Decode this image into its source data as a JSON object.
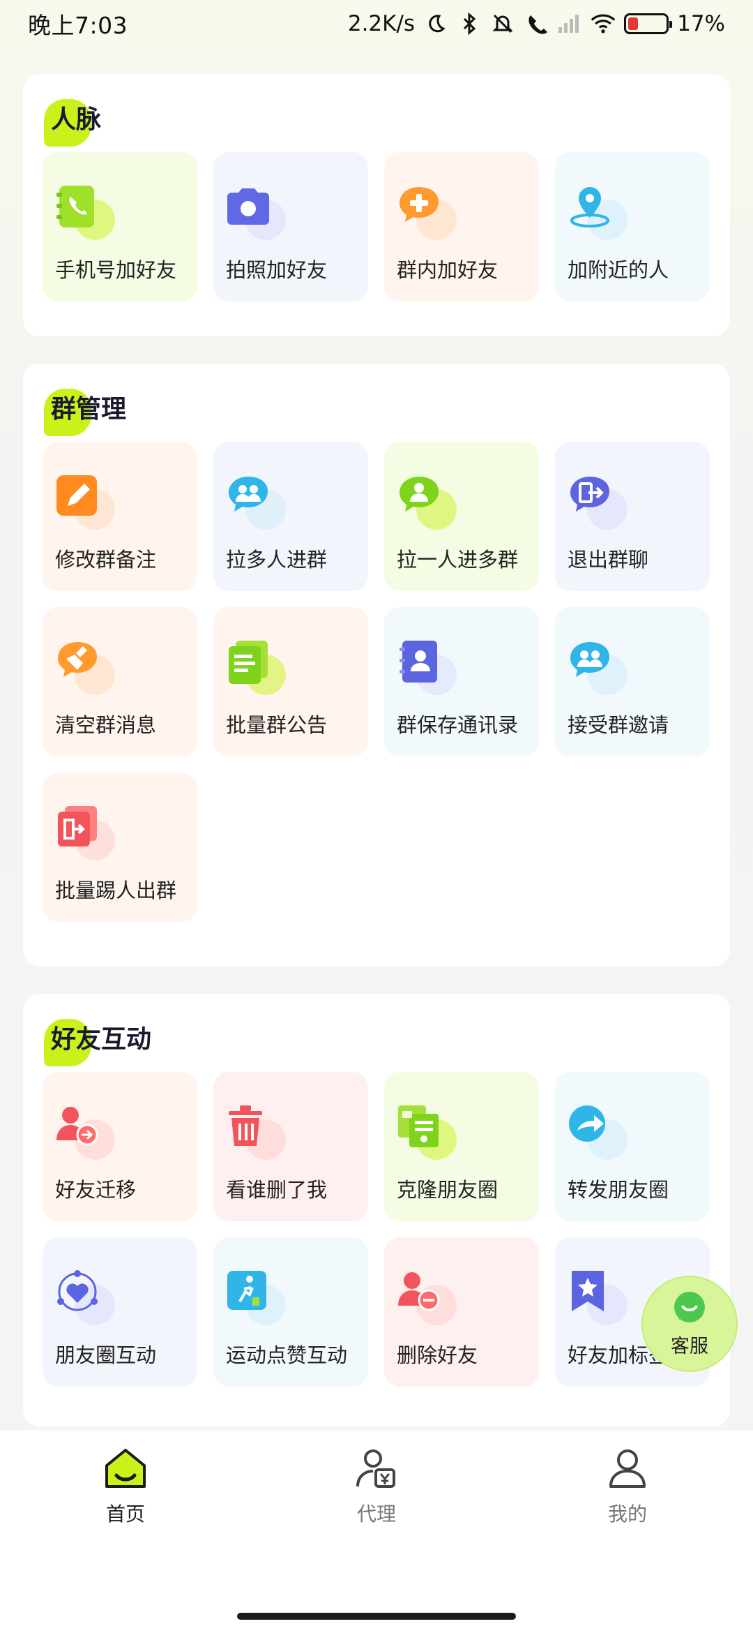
{
  "status_bar": {
    "time": "晚上7:03",
    "net_speed": "2.2K/s",
    "battery": "17%"
  },
  "sections": [
    {
      "title": "人脉",
      "items": [
        {
          "label": "手机号加好友",
          "icon": "phone-book-icon",
          "bg": "green"
        },
        {
          "label": "拍照加好友",
          "icon": "camera-icon",
          "bg": "blue"
        },
        {
          "label": "群内加好友",
          "icon": "chat-plus-icon",
          "bg": "orange"
        },
        {
          "label": "加附近的人",
          "icon": "location-pin-icon",
          "bg": "cyan"
        }
      ]
    },
    {
      "title": "群管理",
      "items": [
        {
          "label": "修改群备注",
          "icon": "edit-note-icon",
          "bg": "orange"
        },
        {
          "label": "拉多人进群",
          "icon": "group-chat-icon",
          "bg": "blue"
        },
        {
          "label": "拉一人进多群",
          "icon": "single-user-chat-icon",
          "bg": "green"
        },
        {
          "label": "退出群聊",
          "icon": "exit-chat-icon",
          "bg": "blue"
        },
        {
          "label": "清空群消息",
          "icon": "clear-broom-icon",
          "bg": "orange"
        },
        {
          "label": "批量群公告",
          "icon": "announcement-doc-icon",
          "bg": "orange"
        },
        {
          "label": "群保存通讯录",
          "icon": "contacts-book-icon",
          "bg": "cyan"
        },
        {
          "label": "接受群邀请",
          "icon": "accept-invite-icon",
          "bg": "cyan"
        },
        {
          "label": "批量踢人出群",
          "icon": "kick-out-icon",
          "bg": "orange"
        }
      ]
    },
    {
      "title": "好友互动",
      "items": [
        {
          "label": "好友迁移",
          "icon": "user-transfer-icon",
          "bg": "orange"
        },
        {
          "label": "看谁删了我",
          "icon": "trash-icon",
          "bg": "pink"
        },
        {
          "label": "克隆朋友圈",
          "icon": "clone-doc-icon",
          "bg": "green"
        },
        {
          "label": "转发朋友圈",
          "icon": "forward-icon",
          "bg": "cyan"
        },
        {
          "label": "朋友圈互动",
          "icon": "heart-circle-icon",
          "bg": "blue"
        },
        {
          "label": "运动点赞互动",
          "icon": "sport-like-icon",
          "bg": "cyan"
        },
        {
          "label": "删除好友",
          "icon": "user-remove-icon",
          "bg": "pink"
        },
        {
          "label": "好友加标签",
          "icon": "star-tag-icon",
          "bg": "blue"
        }
      ]
    }
  ],
  "fab": {
    "label": "客服",
    "icon": "customer-service-icon"
  },
  "bottom_nav": [
    {
      "label": "首页",
      "icon": "home-icon",
      "active": true
    },
    {
      "label": "代理",
      "icon": "agent-icon",
      "active": false
    },
    {
      "label": "我的",
      "icon": "profile-icon",
      "active": false
    }
  ],
  "colors": {
    "accent": "#c9f21b",
    "title_text": "#1a1a2e"
  }
}
